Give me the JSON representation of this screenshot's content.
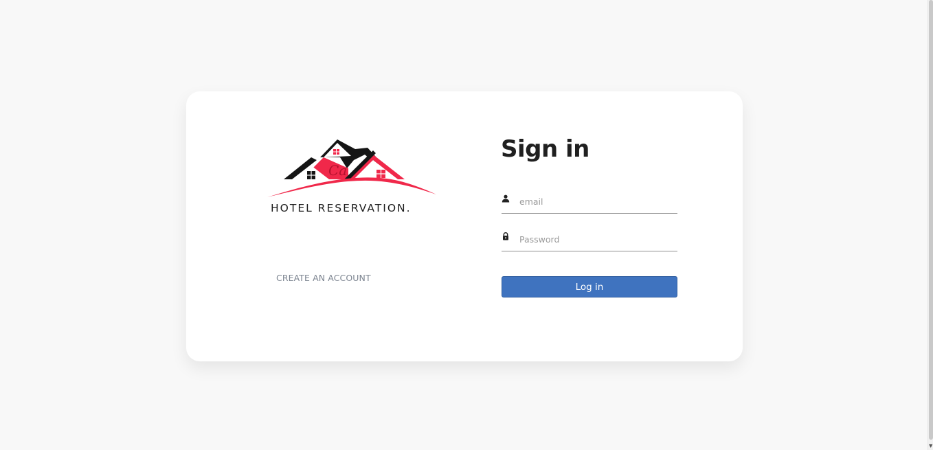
{
  "brand": {
    "logo_text": "HOTEL RESERVATION.",
    "logo_mark": "Ca",
    "colors": {
      "red": "#f0284a",
      "black": "#151515"
    }
  },
  "left": {
    "create_account": "CREATE AN ACCOUNT"
  },
  "form": {
    "title": "Sign in",
    "email": {
      "value": "",
      "placeholder": "email",
      "icon": "user-icon"
    },
    "password": {
      "value": "",
      "placeholder": "Password",
      "icon": "lock-icon"
    },
    "submit_label": "Log in",
    "button_color": "#3f73bf"
  }
}
